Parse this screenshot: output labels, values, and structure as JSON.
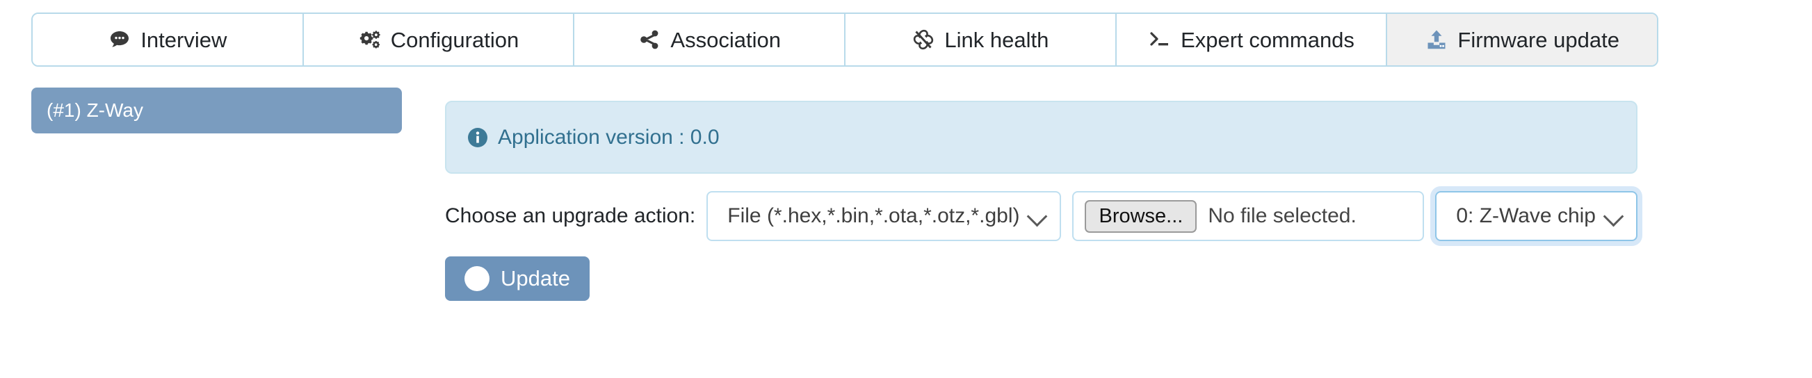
{
  "tabs": [
    {
      "label": "Interview",
      "icon": "comment-icon",
      "active": false
    },
    {
      "label": "Configuration",
      "icon": "gears-icon",
      "active": false
    },
    {
      "label": "Association",
      "icon": "share-nodes-icon",
      "active": false
    },
    {
      "label": "Link health",
      "icon": "broken-link-icon",
      "active": false
    },
    {
      "label": "Expert commands",
      "icon": "terminal-icon",
      "active": false
    },
    {
      "label": "Firmware update",
      "icon": "upload-icon",
      "active": true
    }
  ],
  "sidebar": {
    "items": [
      {
        "label": "(#1) Z-Way",
        "selected": true
      }
    ]
  },
  "main": {
    "alert": {
      "icon": "info-circle-icon",
      "text": "Application version : 0.0"
    },
    "form": {
      "label": "Choose an upgrade action:",
      "action_select": {
        "value": "File (*.hex,*.bin,*.ota,*.otz,*.gbl)",
        "caret_icon": "chevron-down-icon"
      },
      "file_input": {
        "browse_label": "Browse...",
        "status": "No file selected."
      },
      "target_select": {
        "value": "0: Z-Wave chip",
        "caret_icon": "chevron-down-icon",
        "focused": true
      }
    },
    "update_button": {
      "label": "Update",
      "icon": "circle-icon"
    }
  },
  "colors": {
    "tab_border": "#b8daea",
    "tab_active_bg": "#f0f0f0",
    "sidebar_selected_bg": "#7a9cbf",
    "alert_bg": "#d9eaf4",
    "alert_border": "#c8e4ef",
    "alert_text": "#31708f",
    "button_bg": "#6d93ba",
    "input_border": "#bfdff0"
  }
}
